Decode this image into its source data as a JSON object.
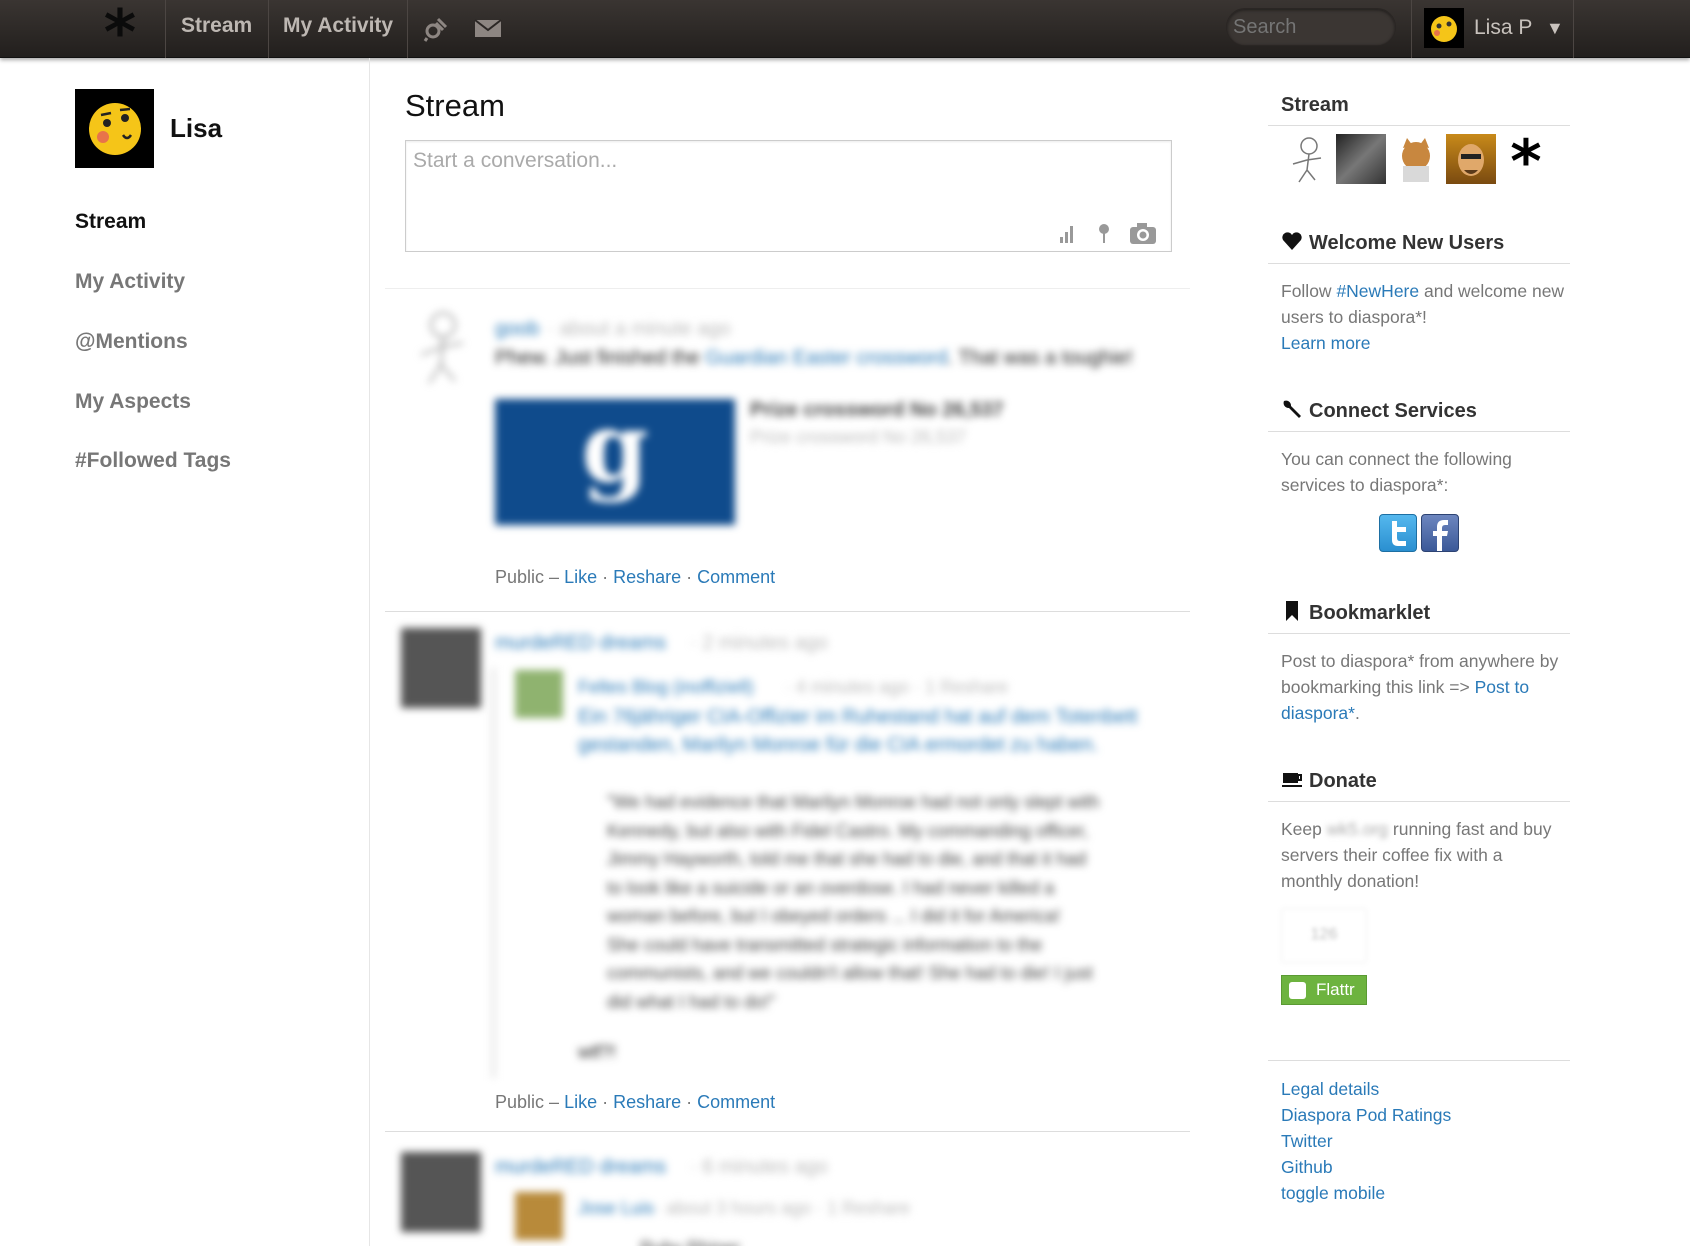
{
  "header": {
    "logo": "*",
    "nav_stream": "Stream",
    "nav_activity": "My Activity",
    "search_placeholder": "Search",
    "user_name": "Lisa P",
    "caret": "▼"
  },
  "sidebar": {
    "profile_name": "Lisa",
    "items": [
      {
        "label": "Stream"
      },
      {
        "label": "My Activity"
      },
      {
        "label": "@Mentions"
      },
      {
        "label": "My Aspects"
      },
      {
        "label": "#Followed Tags"
      }
    ]
  },
  "main": {
    "title": "Stream",
    "publisher_placeholder": "Start a conversation...",
    "posts": [
      {
        "author": "goob",
        "meta": "· about a minute ago",
        "text_before": "Phew. Just finished the ",
        "text_link": "Guardian Easter crossword",
        "text_after": ". That was a toughie!",
        "embed_title": "Prize crossword No 26,537",
        "embed_sub": "Prize crossword No 26,537",
        "embed_logo": "g",
        "visibility": "Public –",
        "like": "Like",
        "reshare": "Reshare",
        "comment": "Comment"
      },
      {
        "author": "murdeRED dreams",
        "meta": "· 2 minutes ago",
        "reshare_author": "Feltes Blog (inoffiziell)",
        "reshare_meta": "· 4 minutes ago · 1 Reshare",
        "reshare_link_1": "Ein 76jähriger CIA-Offizier im Ruhestand hat auf dem Totenbett",
        "reshare_link_2": "gestanden, Marilyn Monroe für die CIA ermordet zu haben.",
        "quote": [
          "\"We had evidence that Marilyn Monroe had not only slept with",
          "Kennedy, but also with Fidel Castro. My commanding officer,",
          "Jimmy Hayworth, told me that she had to die, and that it had",
          "to look like a suicide or an overdose. I had never killed a",
          "woman before, but I obeyed orders ... I did it for America!",
          "She could have transmitted strategic information to the",
          "communists, and we couldn't allow that! She had to die! I just",
          "did what I had to do!\""
        ],
        "tail": "wtf?!",
        "visibility": "Public –",
        "like": "Like",
        "reshare": "Reshare",
        "comment": "Comment"
      },
      {
        "author": "murdeRED dreams",
        "meta": "· 6 minutes ago",
        "reshare_author": "Jose Luis",
        "reshare_meta": "· about 3 hours ago · 1 Reshare",
        "nested_author": "Ruby Rhiner"
      }
    ]
  },
  "right": {
    "stream_title": "Stream",
    "welcome_title": "Welcome New Users",
    "welcome_text_1": "Follow ",
    "welcome_tag": "#NewHere",
    "welcome_text_2": " and welcome new users to diaspora*!",
    "welcome_learn": "Learn more",
    "connect_title": "Connect Services",
    "connect_text": "You can connect the following services to diaspora*:",
    "bookmarklet_title": "Bookmarklet",
    "bookmarklet_text": "Post to diaspora* from anywhere by bookmarking this link => ",
    "bookmarklet_link": "Post to diaspora*",
    "bookmarklet_end": ".",
    "donate_title": "Donate",
    "donate_text_1": "Keep ",
    "donate_blurred": "wk5.org",
    "donate_text_2": " running fast and buy servers their coffee fix with a monthly donation!",
    "flattr_count": "126",
    "flattr_label": "Flattr",
    "footer": [
      {
        "label": "Legal details"
      },
      {
        "label": "Diaspora Pod Ratings"
      },
      {
        "label": "Twitter"
      },
      {
        "label": "Github"
      },
      {
        "label": "toggle mobile"
      }
    ]
  }
}
